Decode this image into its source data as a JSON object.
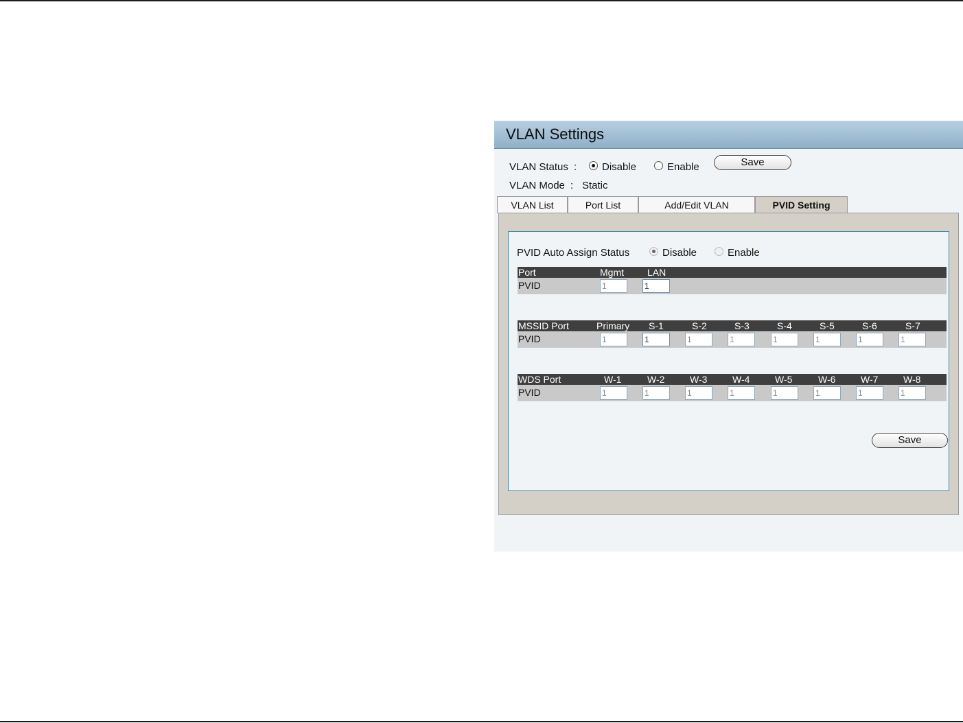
{
  "panel": {
    "title": "VLAN Settings"
  },
  "vlan_status": {
    "label": "VLAN Status",
    "sep": ":",
    "options": [
      "Disable",
      "Enable"
    ],
    "selected": "Disable",
    "save_label": "Save"
  },
  "vlan_mode": {
    "label": "VLAN Mode",
    "sep": ":",
    "value": "Static"
  },
  "tabs": [
    {
      "label": "VLAN List",
      "active": false
    },
    {
      "label": "Port List",
      "active": false
    },
    {
      "label": "Add/Edit VLAN",
      "active": false
    },
    {
      "label": "PVID Setting",
      "active": true
    }
  ],
  "pvid_auto": {
    "label": "PVID Auto Assign Status",
    "options": [
      "Disable",
      "Enable"
    ],
    "selected": "Disable"
  },
  "port_table": {
    "headers": [
      "Port",
      "Mgmt",
      "LAN"
    ],
    "row_label": "PVID",
    "values": [
      "1",
      "1"
    ]
  },
  "mssid_table": {
    "headers": [
      "MSSID Port",
      "Primary",
      "S-1",
      "S-2",
      "S-3",
      "S-4",
      "S-5",
      "S-6",
      "S-7"
    ],
    "row_label": "PVID",
    "values": [
      "1",
      "1",
      "1",
      "1",
      "1",
      "1",
      "1",
      "1"
    ]
  },
  "wds_table": {
    "headers": [
      "WDS Port",
      "W-1",
      "W-2",
      "W-3",
      "W-4",
      "W-5",
      "W-6",
      "W-7",
      "W-8"
    ],
    "row_label": "PVID",
    "values": [
      "1",
      "1",
      "1",
      "1",
      "1",
      "1",
      "1",
      "1"
    ]
  },
  "bottom_save_label": "Save"
}
